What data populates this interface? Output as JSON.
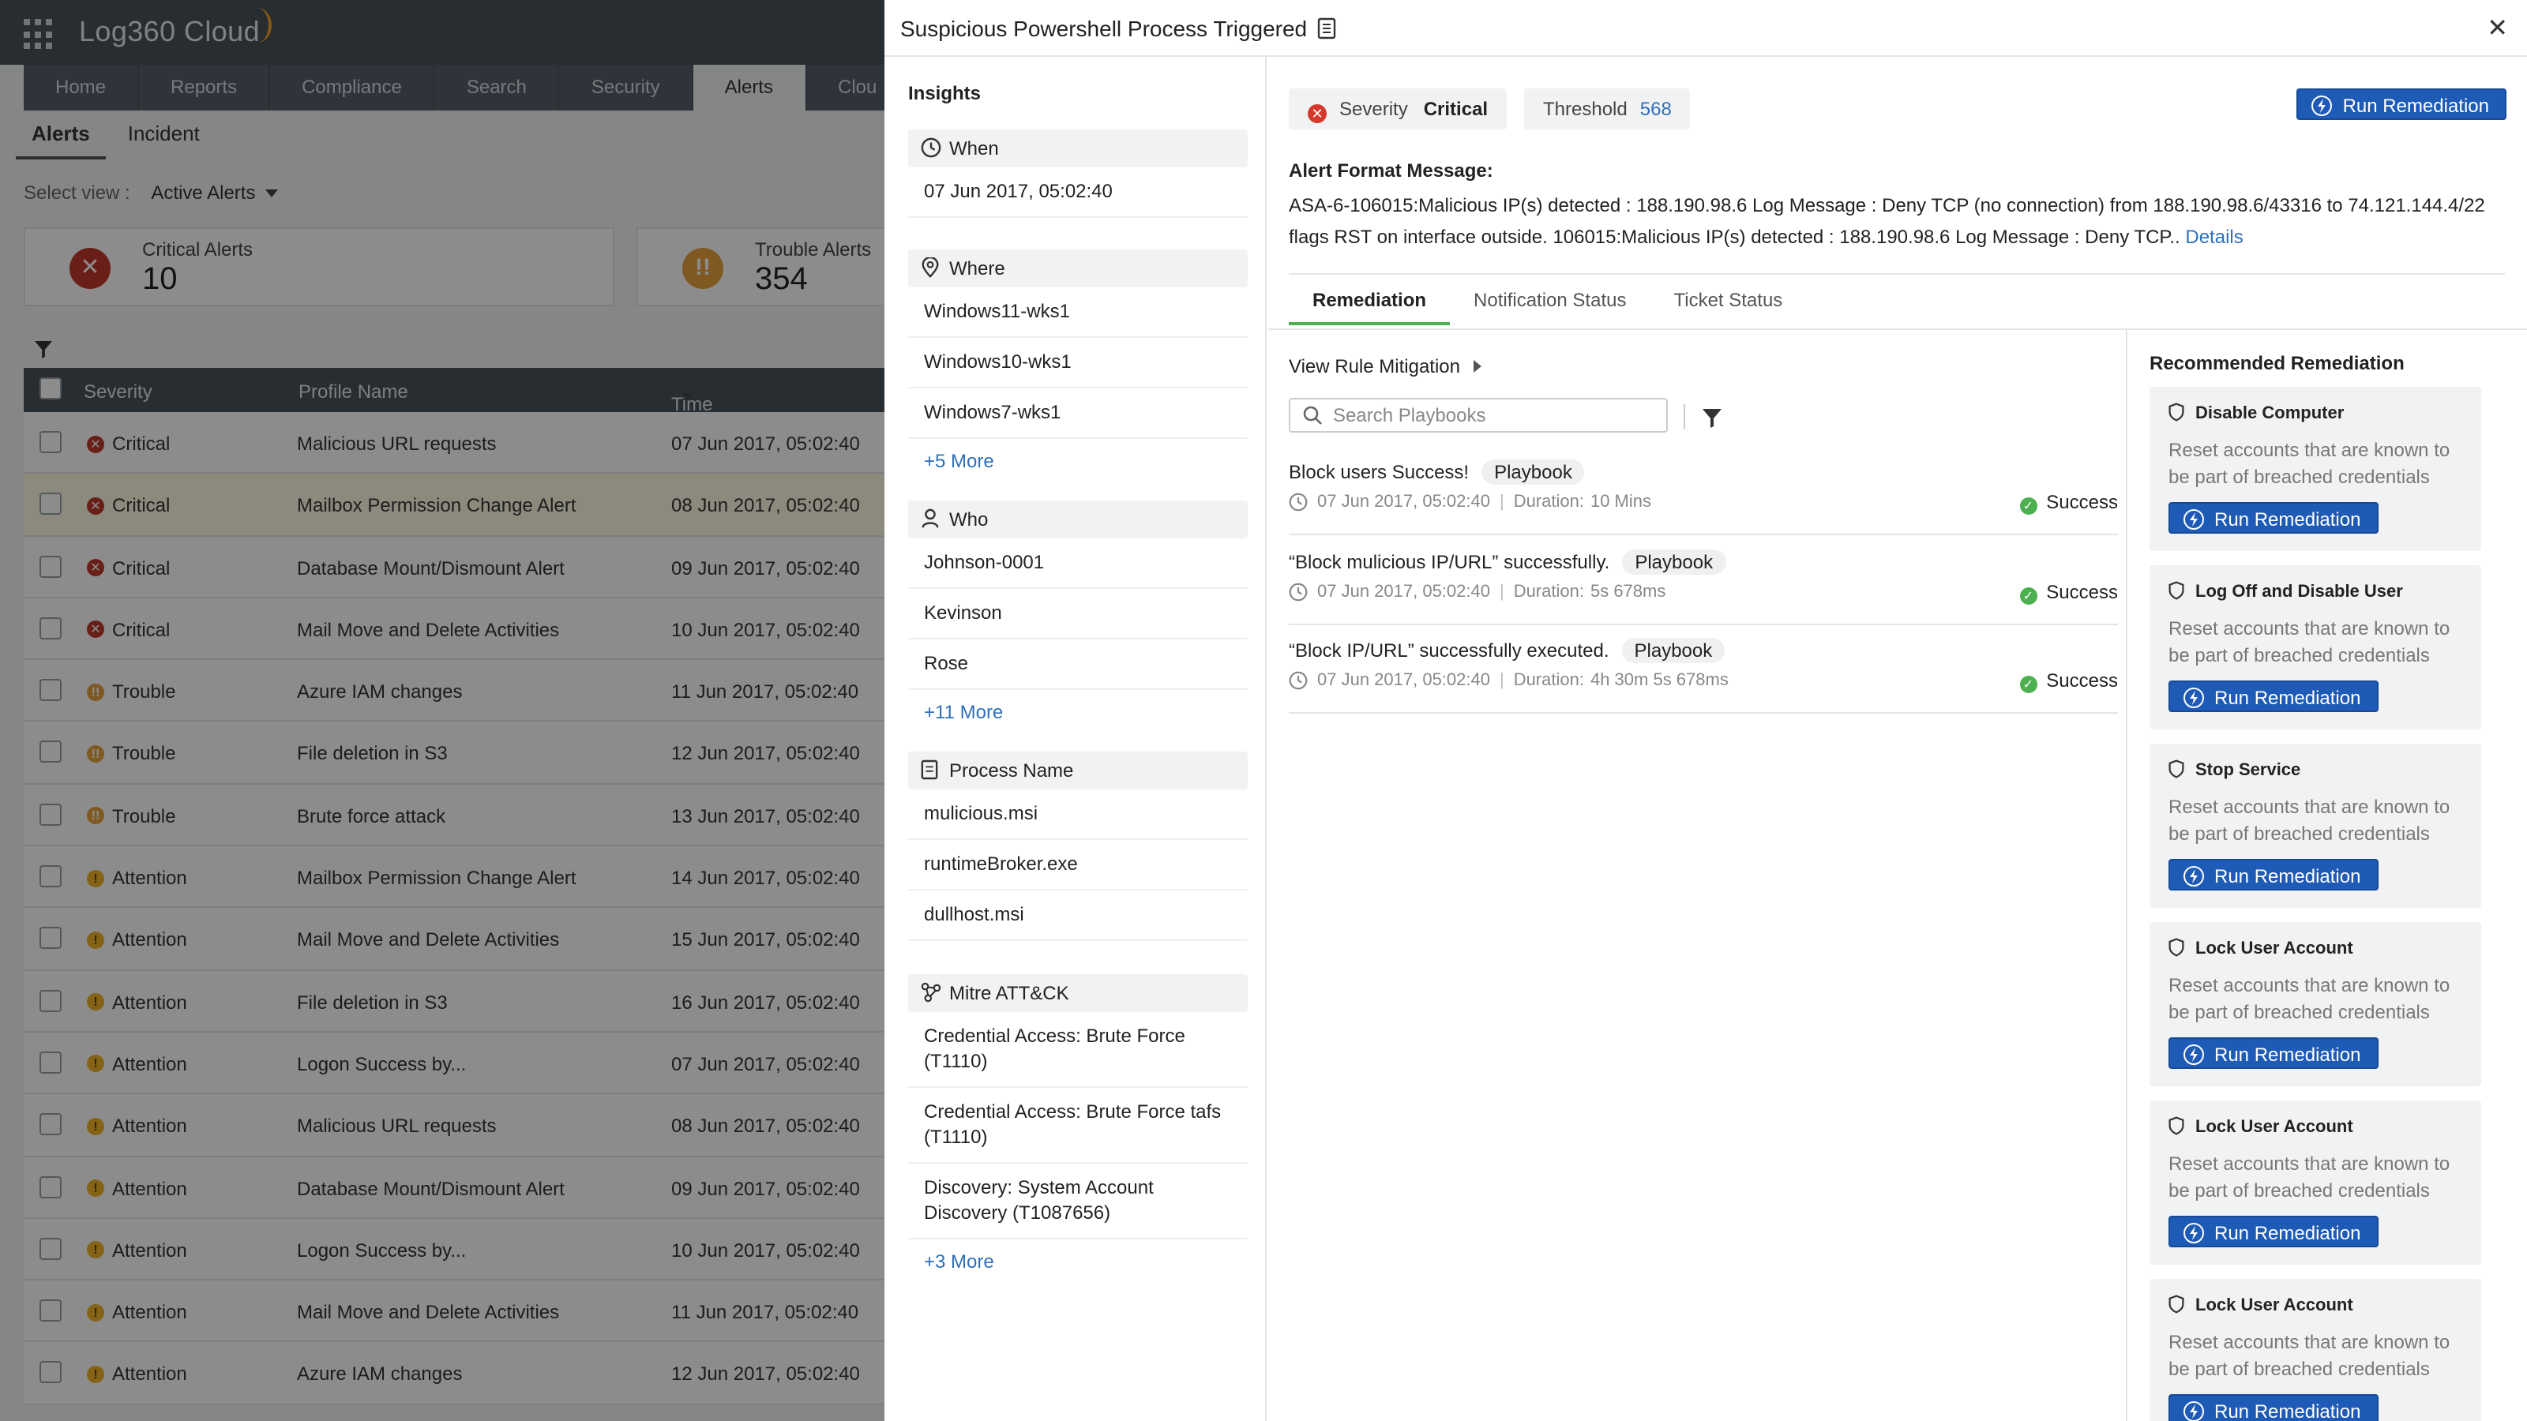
{
  "app": {
    "logo": "Log360 Cloud",
    "nav_tabs": [
      "Home",
      "Reports",
      "Compliance",
      "Search",
      "Security",
      "Alerts",
      "Clou"
    ],
    "active_nav": "Alerts",
    "sub_tabs": [
      "Alerts",
      "Incident"
    ],
    "select_view_label": "Select view :",
    "select_view_value": "Active Alerts",
    "cards": [
      {
        "label": "Critical Alerts",
        "value": "10",
        "icon": "x-circle-icon",
        "color": "#c0392b"
      },
      {
        "label": "Trouble Alerts",
        "value": "354",
        "icon": "exclamation-circle-icon",
        "color": "#e8a33c"
      }
    ],
    "table": {
      "headers": [
        "Severity",
        "Profile Name",
        "Time Generated"
      ],
      "rows": [
        {
          "severity": "Critical",
          "profile": "Malicious URL requests",
          "time": "07 Jun 2017, 05:02:40"
        },
        {
          "severity": "Critical",
          "profile": "Mailbox Permission Change Alert",
          "time": "08 Jun 2017, 05:02:40"
        },
        {
          "severity": "Critical",
          "profile": "Database Mount/Dismount Alert",
          "time": "09 Jun 2017, 05:02:40"
        },
        {
          "severity": "Critical",
          "profile": "Mail Move and Delete Activities",
          "time": "10 Jun 2017, 05:02:40"
        },
        {
          "severity": "Trouble",
          "profile": "Azure IAM changes",
          "time": "11 Jun 2017, 05:02:40"
        },
        {
          "severity": "Trouble",
          "profile": "File deletion in S3",
          "time": "12 Jun 2017, 05:02:40"
        },
        {
          "severity": "Trouble",
          "profile": "Brute force attack",
          "time": "13 Jun 2017, 05:02:40"
        },
        {
          "severity": "Attention",
          "profile": "Mailbox Permission Change Alert",
          "time": "14 Jun 2017, 05:02:40"
        },
        {
          "severity": "Attention",
          "profile": "Mail Move and Delete Activities",
          "time": "15 Jun 2017, 05:02:40"
        },
        {
          "severity": "Attention",
          "profile": "File deletion in S3",
          "time": "16 Jun 2017, 05:02:40"
        },
        {
          "severity": "Attention",
          "profile": "Logon Success by...",
          "time": "07 Jun 2017, 05:02:40"
        },
        {
          "severity": "Attention",
          "profile": "Malicious URL requests",
          "time": "08 Jun 2017, 05:02:40"
        },
        {
          "severity": "Attention",
          "profile": "Database Mount/Dismount Alert",
          "time": "09 Jun 2017, 05:02:40"
        },
        {
          "severity": "Attention",
          "profile": "Logon Success by...",
          "time": "10 Jun 2017, 05:02:40"
        },
        {
          "severity": "Attention",
          "profile": "Mail Move and Delete Activities",
          "time": "11 Jun 2017, 05:02:40"
        },
        {
          "severity": "Attention",
          "profile": "Azure IAM changes",
          "time": "12 Jun 2017, 05:02:40"
        }
      ]
    }
  },
  "panel": {
    "title": "Suspicious Powershell Process Triggered",
    "close": "✕",
    "insights": {
      "title": "Insights",
      "when": {
        "label": "When",
        "items": [
          "07 Jun 2017, 05:02:40"
        ],
        "more": ""
      },
      "where": {
        "label": "Where",
        "items": [
          "Windows11-wks1",
          "Windows10-wks1",
          "Windows7-wks1"
        ],
        "more": "+5 More"
      },
      "who": {
        "label": "Who",
        "items": [
          "Johnson-0001",
          "Kevinson",
          "Rose"
        ],
        "more": "+11 More"
      },
      "process": {
        "label": "Process Name",
        "items": [
          "mulicious.msi",
          "runtimeBroker.exe",
          "dullhost.msi"
        ],
        "more": ""
      },
      "mitre": {
        "label": "Mitre ATT&CK",
        "items": [
          "Credential Access: Brute Force (T1110)",
          "Credential Access: Brute Force tafs (T1110)",
          "Discovery: System Account Discovery (T1087656)"
        ],
        "more": "+3 More"
      }
    },
    "severity_label": "Severity",
    "severity_value": "Critical",
    "threshold_label": "Threshold",
    "threshold_value": "568",
    "run_remediation": "Run Remediation",
    "alert_format_title": "Alert Format Message:",
    "alert_format_text": "ASA-6-106015:Malicious IP(s) detected : 188.190.98.6 Log Message : Deny TCP (no connection) from 188.190.98.6/43316 to 74.121.144.4/22 flags RST on interface outside. 106015:Malicious IP(s) detected : 188.190.98.6 Log Message : Deny TCP..",
    "details_link": "Details",
    "tabs": [
      "Remediation",
      "Notification Status",
      "Ticket Status"
    ],
    "active_tab": "Remediation",
    "view_rule_mitigation": "View Rule Mitigation",
    "search_placeholder": "Search Playbooks",
    "playbooks": [
      {
        "title": "Block users Success!",
        "tag": "Playbook",
        "time": "07 Jun 2017, 05:02:40",
        "duration_label": "Duration:",
        "duration": "10 Mins",
        "status": "Success"
      },
      {
        "title": "“Block mulicious IP/URL” successfully.",
        "tag": "Playbook",
        "time": "07 Jun 2017, 05:02:40",
        "duration_label": "Duration:",
        "duration": "5s 678ms",
        "status": "Success"
      },
      {
        "title": "“Block IP/URL” successfully executed.",
        "tag": "Playbook",
        "time": "07 Jun 2017, 05:02:40",
        "duration_label": "Duration:",
        "duration": "4h 30m 5s 678ms",
        "status": "Success"
      }
    ],
    "recommended_title": "Recommended Remediation",
    "recommended": [
      {
        "title": "Disable Computer",
        "desc": "Reset accounts that are known to be part of breached credentials",
        "button": "Run Remediation"
      },
      {
        "title": "Log Off and Disable User",
        "desc": "Reset accounts that are known to be part of breached credentials",
        "button": "Run Remediation"
      },
      {
        "title": "Stop Service",
        "desc": "Reset accounts that are known to be part of breached credentials",
        "button": "Run Remediation"
      },
      {
        "title": "Lock User Account",
        "desc": "Reset accounts that are known to be part of breached credentials",
        "button": "Run Remediation"
      },
      {
        "title": "Lock User Account",
        "desc": "Reset accounts that are known to be part of breached credentials",
        "button": "Run Remediation"
      },
      {
        "title": "Lock User Account",
        "desc": "Reset accounts that are known to be part of breached credentials",
        "button": "Run Remediation"
      }
    ]
  }
}
